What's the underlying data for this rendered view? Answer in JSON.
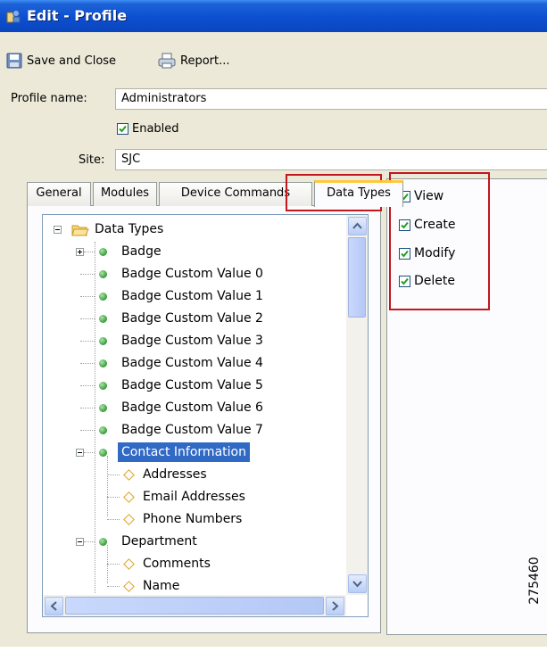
{
  "window": {
    "title": "Edit - Profile",
    "title_icon": "profile-window-icon"
  },
  "toolbar": {
    "save_close_label": "Save and Close",
    "report_label": "Report..."
  },
  "form": {
    "profile_name_label": "Profile name:",
    "profile_name_value": "Administrators",
    "enabled_label": "Enabled",
    "enabled_checked": true,
    "site_label": "Site:",
    "site_value": "SJC"
  },
  "tabs": [
    {
      "label": "General"
    },
    {
      "label": "Modules"
    },
    {
      "label": "Device Commands"
    },
    {
      "label": "Data Types",
      "active": true
    }
  ],
  "tree": {
    "root": "Data Types",
    "items": [
      {
        "label": "Badge",
        "expandable": true,
        "expanded": false
      },
      {
        "label": "Badge Custom Value 0"
      },
      {
        "label": "Badge Custom Value 1"
      },
      {
        "label": "Badge Custom Value 2"
      },
      {
        "label": "Badge Custom Value 3"
      },
      {
        "label": "Badge Custom Value 4"
      },
      {
        "label": "Badge Custom Value 5"
      },
      {
        "label": "Badge Custom Value 6"
      },
      {
        "label": "Badge Custom Value 7"
      },
      {
        "label": "Contact Information",
        "expandable": true,
        "expanded": true,
        "selected": true
      },
      {
        "label": "Addresses",
        "child": true
      },
      {
        "label": "Email Addresses",
        "child": true
      },
      {
        "label": "Phone Numbers",
        "child": true
      },
      {
        "label": "Department",
        "expandable": true,
        "expanded": true
      },
      {
        "label": "Comments",
        "child": true
      },
      {
        "label": "Name",
        "child": true
      }
    ]
  },
  "permissions": [
    {
      "label": "View",
      "checked": true
    },
    {
      "label": "Create",
      "checked": true
    },
    {
      "label": "Modify",
      "checked": true
    },
    {
      "label": "Delete",
      "checked": true
    }
  ],
  "figure_id": "275460",
  "colors": {
    "title_bar": "#0d4fd0",
    "highlight_box": "#c4161c",
    "selection": "#316ac5",
    "tab_accent": "#ffc83c"
  }
}
